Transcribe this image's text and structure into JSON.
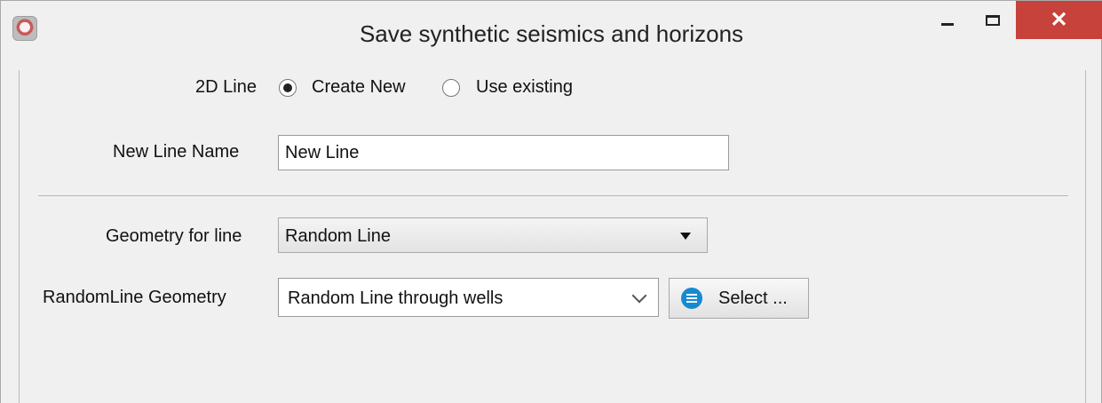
{
  "window": {
    "title": "Save synthetic seismics and horizons"
  },
  "form": {
    "line_type_label": "2D Line",
    "create_new_label": "Create New",
    "use_existing_label": "Use existing",
    "new_line_name_label": "New Line Name",
    "new_line_name_value": "New Line",
    "geometry_label": "Geometry for line",
    "geometry_value": "Random Line",
    "random_line_geometry_label": "RandomLine Geometry",
    "random_line_geometry_value": "Random Line through wells",
    "select_button_label": "Select ..."
  }
}
